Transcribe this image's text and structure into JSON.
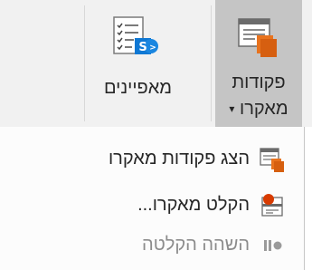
{
  "ribbon": {
    "macros_button": {
      "line1": "פקודות",
      "line2": "מאקרו",
      "dropdown_arrow": "▾"
    },
    "properties_button": {
      "label": "מאפיינים"
    }
  },
  "menu": {
    "items": [
      {
        "label": "הצג פקודות מאקרו",
        "icon": "view-macros-icon",
        "enabled": true
      },
      {
        "label": "הקלט מאקרו...",
        "icon": "record-macro-icon",
        "enabled": true
      },
      {
        "label": "השהה הקלטה",
        "icon": "pause-recording-icon",
        "enabled": false
      }
    ]
  },
  "colors": {
    "ribbon_bg": "#f1f1f1",
    "selected_button_bg": "#c5c5c5",
    "accent_orange": "#e8731e",
    "record_red": "#d83b01",
    "sharepoint_blue": "#0f78d4",
    "disabled_text": "#8c8c8c"
  }
}
